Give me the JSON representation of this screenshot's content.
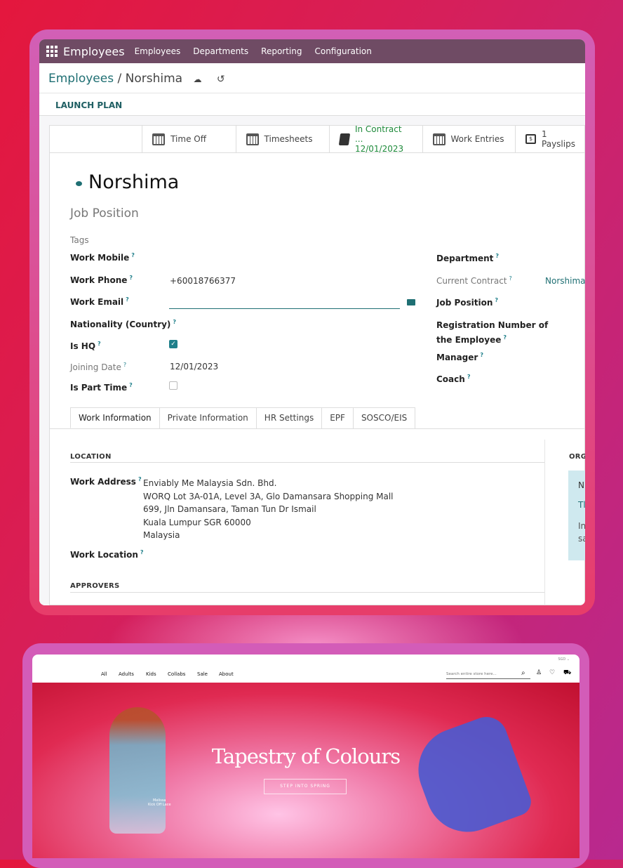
{
  "odoo": {
    "app_name": "Employees",
    "menu": [
      "Employees",
      "Departments",
      "Reporting",
      "Configuration"
    ],
    "breadcrumb": {
      "parent": "Employees",
      "separator": " / ",
      "current": "Norshima"
    },
    "launch_plan": "LAUNCH PLAN",
    "stats": {
      "time_off": "Time Off",
      "timesheets": "Timesheets",
      "contract_label": "In Contract ...",
      "contract_date": "12/01/2023",
      "work_entries": "Work Entries",
      "payslips_count": "1",
      "payslips_label": "Payslips"
    },
    "employee_name": "Norshima",
    "job_position_placeholder": "Job Position",
    "tags_placeholder": "Tags",
    "left_fields": {
      "work_mobile": "Work Mobile",
      "work_phone": "Work Phone",
      "work_phone_value": "+60018766377",
      "work_email": "Work Email",
      "nationality": "Nationality (Country)",
      "is_hq": "Is HQ",
      "is_hq_checked": true,
      "joining_date": "Joining Date",
      "joining_date_value": "12/01/2023",
      "is_part_time": "Is Part Time",
      "is_part_time_checked": false
    },
    "right_fields": {
      "department": "Department",
      "current_contract": "Current Contract",
      "current_contract_value": "Norshima",
      "job_position": "Job Position",
      "registration_1": "Registration Number of",
      "registration_2": "the Employee",
      "manager": "Manager",
      "coach": "Coach"
    },
    "help_mark": "?",
    "tabs": [
      "Work Information",
      "Private Information",
      "HR Settings",
      "EPF",
      "SOSCO/EIS"
    ],
    "location_heading": "LOCATION",
    "work_address_label": "Work Address",
    "work_address_lines": [
      "Enviably Me Malaysia Sdn. Bhd.",
      "WORQ Lot 3A-01A, Level 3A, Glo Damansara Shopping Mall",
      "699, Jln Damansara, Taman Tun Dr Ismail",
      "Kuala Lumpur SGR 60000",
      "Malaysia"
    ],
    "work_location_label": "Work Location",
    "approvers_heading": "APPROVERS",
    "org_heading": "ORG",
    "info_letters": [
      "N",
      "Tl",
      "In",
      "sa"
    ],
    "accent": "#1f6f73",
    "navbar_color": "#6f4b64"
  },
  "store": {
    "currency": "SGD",
    "nav": [
      "All",
      "Adults",
      "Kids",
      "Collabs",
      "Sale",
      "About"
    ],
    "search_placeholder": "Search entire store here...",
    "hero_title": "Tapestry of Colours",
    "cta": "STEP INTO SPRING",
    "caption_1": "Melissa",
    "caption_2": "Kick Off Lace"
  }
}
